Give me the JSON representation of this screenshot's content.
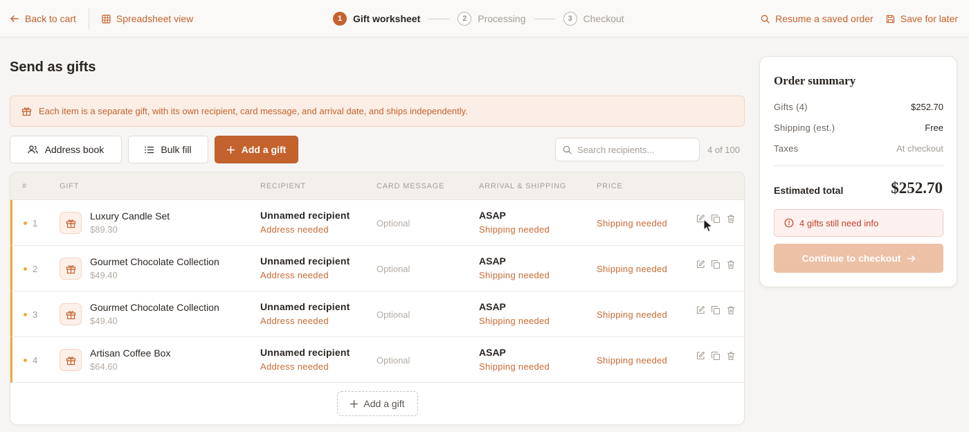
{
  "topbar": {
    "back_label": "Back to cart",
    "spreadsheet_label": "Spreadsheet view",
    "resume_label": "Resume a saved order",
    "save_label": "Save for later"
  },
  "steps": [
    {
      "num": "1",
      "label": "Gift worksheet",
      "state": "active"
    },
    {
      "num": "2",
      "label": "Processing",
      "state": "inactive"
    },
    {
      "num": "3",
      "label": "Checkout",
      "state": "inactive"
    }
  ],
  "page": {
    "title": "Send as gifts",
    "banner": "Each item is a separate gift, with its own recipient, card message, and arrival date, and ships independently."
  },
  "actions": {
    "address_book": "Address book",
    "bulk_fill": "Bulk fill",
    "add_gift": "Add a gift"
  },
  "search": {
    "placeholder": "Search recipients...",
    "count": "4 of 100"
  },
  "table": {
    "headers": [
      "#",
      "GIFT",
      "RECIPIENT",
      "CARD MESSAGE",
      "ARRIVAL & SHIPPING",
      "PRICE"
    ],
    "rows": [
      {
        "index": "1",
        "gift": "Luxury Candle Set",
        "price": "$89.30",
        "recipient": "Unnamed recipient",
        "recipient_status": "Address needed",
        "card": "Optional",
        "arrival": "ASAP",
        "arrival_status": "Shipping needed",
        "price_status": "Shipping needed"
      },
      {
        "index": "2",
        "gift": "Gourmet Chocolate Collection",
        "price": "$49.40",
        "recipient": "Unnamed recipient",
        "recipient_status": "Address needed",
        "card": "Optional",
        "arrival": "ASAP",
        "arrival_status": "Shipping needed",
        "price_status": "Shipping needed"
      },
      {
        "index": "3",
        "gift": "Gourmet Chocolate Collection",
        "price": "$49.40",
        "recipient": "Unnamed recipient",
        "recipient_status": "Address needed",
        "card": "Optional",
        "arrival": "ASAP",
        "arrival_status": "Shipping needed",
        "price_status": "Shipping needed"
      },
      {
        "index": "4",
        "gift": "Artisan Coffee Box",
        "price": "$64.60",
        "recipient": "Unnamed recipient",
        "recipient_status": "Address needed",
        "card": "Optional",
        "arrival": "ASAP",
        "arrival_status": "Shipping needed",
        "price_status": "Shipping needed"
      }
    ],
    "add_row_label": "Add a gift"
  },
  "summary": {
    "title": "Order summary",
    "gifts_label": "Gifts (4)",
    "gifts_value": "$252.70",
    "shipping_label": "Shipping (est.)",
    "shipping_value": "Free",
    "taxes_label": "Taxes",
    "taxes_value": "At checkout",
    "total_label": "Estimated total",
    "total_value": "$252.70",
    "warning": "4 gifts still need info",
    "checkout_label": "Continue to checkout"
  },
  "colors": {
    "accent": "#c4622d",
    "row_marker": "#f0a93a",
    "warning": "#c0402d",
    "checkout_disabled": "#ecc1a6"
  }
}
